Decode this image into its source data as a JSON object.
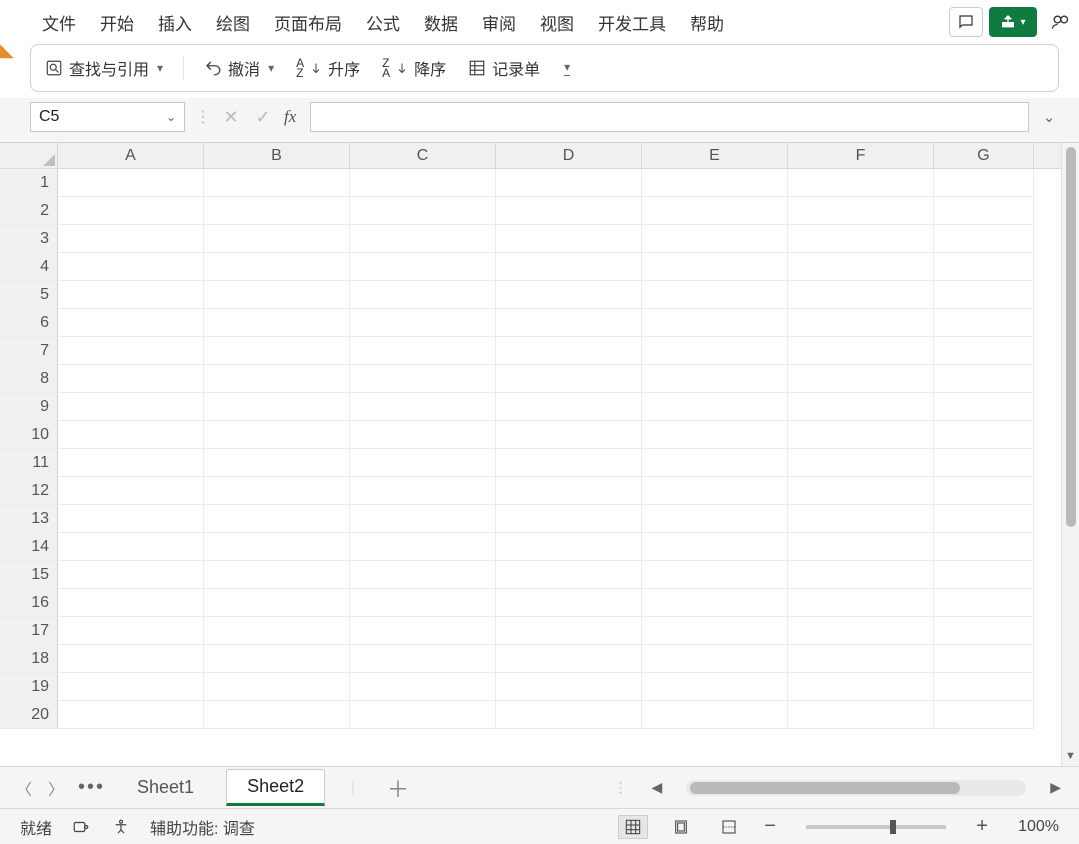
{
  "menu": {
    "items": [
      "文件",
      "开始",
      "插入",
      "绘图",
      "页面布局",
      "公式",
      "数据",
      "审阅",
      "视图",
      "开发工具",
      "帮助"
    ]
  },
  "ribbon": {
    "lookup": "查找与引用",
    "undo": "撤消",
    "asc": "升序",
    "desc": "降序",
    "form": "记录单"
  },
  "namebox": {
    "value": "C5"
  },
  "formula": {
    "value": ""
  },
  "columns": [
    "A",
    "B",
    "C",
    "D",
    "E",
    "F",
    "G"
  ],
  "rows": [
    "1",
    "2",
    "3",
    "4",
    "5",
    "6",
    "7",
    "8",
    "9",
    "10",
    "11",
    "12",
    "13",
    "14",
    "15",
    "16",
    "17",
    "18",
    "19",
    "20"
  ],
  "sheets": {
    "items": [
      "Sheet1",
      "Sheet2"
    ],
    "active": 1
  },
  "status": {
    "ready": "就绪",
    "accessibility": "辅助功能: 调查",
    "zoom": "100%"
  }
}
